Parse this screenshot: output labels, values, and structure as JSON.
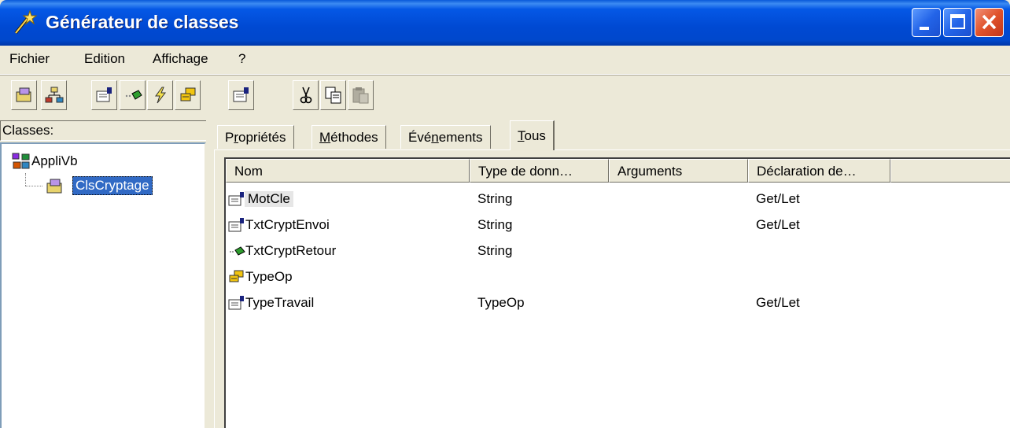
{
  "window": {
    "title": "Générateur de classes"
  },
  "menu": {
    "items": [
      "Fichier",
      "Edition",
      "Affichage",
      "?"
    ]
  },
  "toolbar": {
    "buttons": [
      "class-icon",
      "collection-icon",
      "property-icon",
      "method-icon",
      "event-icon",
      "enum-icon",
      "properties-icon",
      "cut-icon",
      "copy-icon",
      "paste-icon"
    ]
  },
  "left_pane": {
    "label": "Classes:",
    "tree": {
      "root": "AppliVb",
      "child": "ClsCryptage"
    }
  },
  "tabs": {
    "items": [
      {
        "pre": "P",
        "u": "r",
        "post": "opriétés"
      },
      {
        "pre": "",
        "u": "M",
        "post": "éthodes"
      },
      {
        "pre": "Évé",
        "u": "n",
        "post": "ements"
      },
      {
        "pre": "",
        "u": "T",
        "post": "ous"
      }
    ],
    "active": "Tous"
  },
  "list": {
    "columns": [
      "Nom",
      "Type de donn…",
      "Arguments",
      "Déclaration de…"
    ],
    "rows": [
      {
        "icon": "property-icon",
        "name": "MotCle",
        "type": "String",
        "arguments": "",
        "declaration": "Get/Let"
      },
      {
        "icon": "property-icon",
        "name": "TxtCryptEnvoi",
        "type": "String",
        "arguments": "",
        "declaration": "Get/Let"
      },
      {
        "icon": "method-icon",
        "name": "TxtCryptRetour",
        "type": "String",
        "arguments": "",
        "declaration": ""
      },
      {
        "icon": "enum-icon",
        "name": "TypeOp",
        "type": "",
        "arguments": "",
        "declaration": ""
      },
      {
        "icon": "property-icon",
        "name": "TypeTravail",
        "type": "TypeOp",
        "arguments": "",
        "declaration": "Get/Let"
      }
    ]
  }
}
